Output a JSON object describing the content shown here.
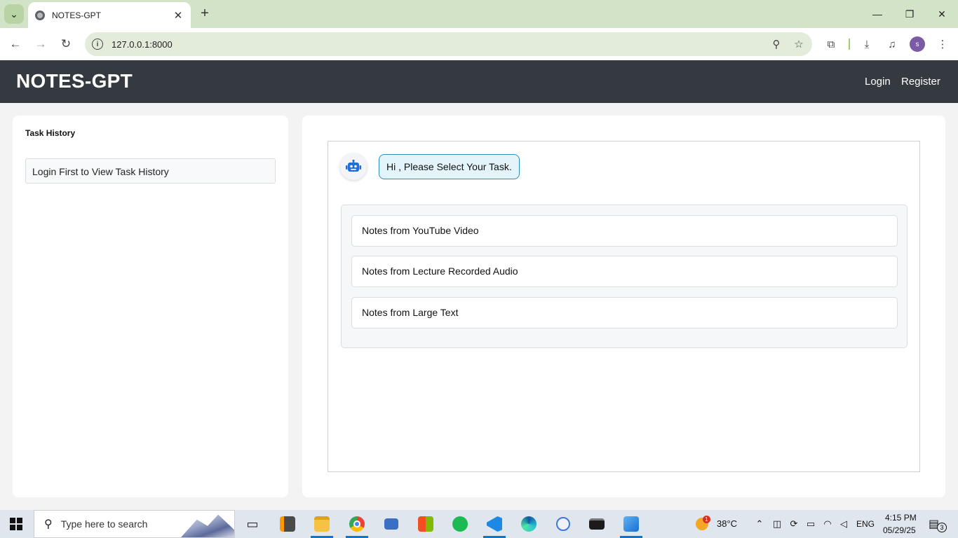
{
  "browser": {
    "tab_title": "NOTES-GPT",
    "url": "127.0.0.1:8000",
    "profile_initial": "s",
    "tab_close_glyph": "✕",
    "new_tab_glyph": "+",
    "win_minimize_glyph": "—",
    "win_restore_glyph": "❐",
    "win_close_glyph": "✕",
    "back_glyph": "←",
    "forward_glyph": "→",
    "reload_glyph": "↻",
    "zoom_glyph": "⚲",
    "star_glyph": "☆",
    "extensions_glyph": "⧉",
    "download_glyph": "⤓",
    "media_glyph": "♫",
    "menu_glyph": "⋮",
    "info_glyph": "i",
    "tab_menu_glyph": "⌄"
  },
  "header": {
    "brand": "NOTES-GPT",
    "login": "Login",
    "register": "Register"
  },
  "sidebar": {
    "title": "Task History",
    "empty_message": "Login First to View Task History"
  },
  "chat": {
    "greeting": "Hi , Please Select Your Task.",
    "options": [
      {
        "label": "Notes from YouTube Video"
      },
      {
        "label": "Notes from Lecture Recorded Audio"
      },
      {
        "label": "Notes from Large Text"
      }
    ]
  },
  "taskbar": {
    "search_placeholder": "Type here to search",
    "weather": "38°C",
    "weather_badge": "1",
    "language": "ENG",
    "time": "4:15 PM",
    "date": "05/29/25",
    "notification_count": "3",
    "search_glyph": "⚲",
    "taskview_glyph": "▭",
    "tray_up_glyph": "⌃",
    "tray_meet_glyph": "◫",
    "tray_sync_glyph": "⟳",
    "tray_battery_glyph": "▭",
    "tray_wifi_glyph": "◠",
    "tray_volume_glyph": "◁",
    "notification_glyph": "▤"
  },
  "colors": {
    "navbar": "#343a40",
    "accent_bubble": "#2a8fb8",
    "bubble_bg": "#e3f4fb",
    "tabstrip": "#d3e3c8"
  }
}
